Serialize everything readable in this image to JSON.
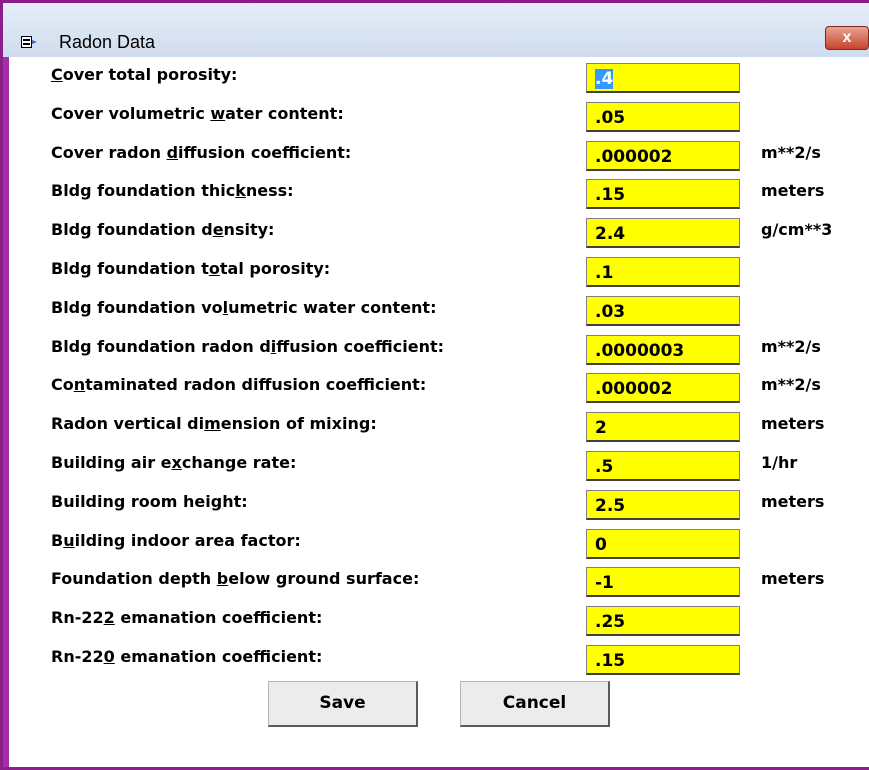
{
  "window": {
    "title": "Radon Data",
    "close_glyph": "x"
  },
  "fields": [
    {
      "pre": "",
      "key": "C",
      "post": "over total porosity:",
      "value": ".4",
      "unit": ""
    },
    {
      "pre": "Cover volumetric ",
      "key": "w",
      "post": "ater content:",
      "value": ".05",
      "unit": ""
    },
    {
      "pre": "Cover radon ",
      "key": "d",
      "post": "iffusion coefficient:",
      "value": ".000002",
      "unit": "m**2/s"
    },
    {
      "pre": "Bldg foundation thic",
      "key": "k",
      "post": "ness:",
      "value": ".15",
      "unit": "meters"
    },
    {
      "pre": "Bldg foundation d",
      "key": "e",
      "post": "nsity:",
      "value": "2.4",
      "unit": "g/cm**3"
    },
    {
      "pre": "Bldg foundation t",
      "key": "o",
      "post": "tal porosity:",
      "value": ".1",
      "unit": ""
    },
    {
      "pre": "Bldg foundation vo",
      "key": "l",
      "post": "umetric water content:",
      "value": ".03",
      "unit": ""
    },
    {
      "pre": "Bldg foundation radon d",
      "key": "i",
      "post": "ffusion coefficient:",
      "value": ".0000003",
      "unit": "m**2/s"
    },
    {
      "pre": "Co",
      "key": "n",
      "post": "taminated radon diffusion coefficient:",
      "value": ".000002",
      "unit": "m**2/s"
    },
    {
      "pre": "Radon vertical di",
      "key": "m",
      "post": "ension of mixing:",
      "value": "2",
      "unit": "meters"
    },
    {
      "pre": "Building air e",
      "key": "x",
      "post": "change rate:",
      "value": ".5",
      "unit": "1/hr"
    },
    {
      "pre": "Building room hei",
      "key": "g",
      "post": "ht:",
      "value": "2.5",
      "unit": "meters"
    },
    {
      "pre": "B",
      "key": "u",
      "post": "ilding indoor area factor:",
      "value": "0",
      "unit": ""
    },
    {
      "pre": "Foundation depth ",
      "key": "b",
      "post": "elow ground surface:",
      "value": "-1",
      "unit": "meters"
    },
    {
      "pre": "Rn-22",
      "key": "2",
      "post": " emanation coefficient:",
      "value": ".25",
      "unit": ""
    },
    {
      "pre": "Rn-22",
      "key": "0",
      "post": " emanation coefficient:",
      "value": ".15",
      "unit": ""
    }
  ],
  "buttons": {
    "save": "Save",
    "cancel": "Cancel"
  }
}
